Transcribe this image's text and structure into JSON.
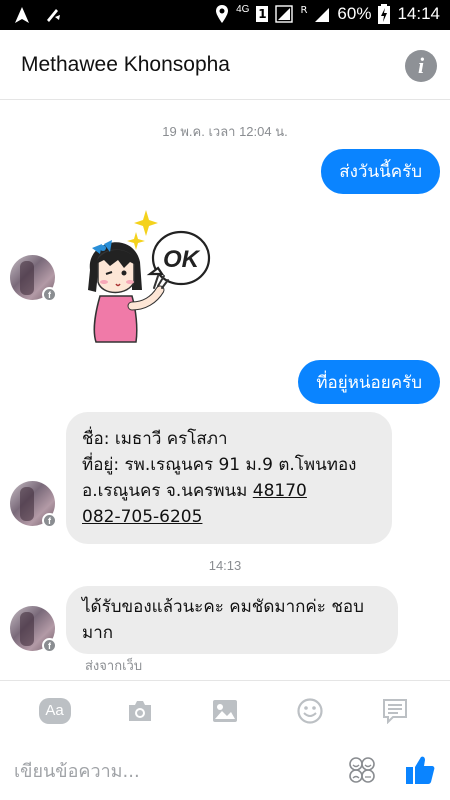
{
  "status_bar": {
    "network": "4G",
    "sim": "1",
    "roaming": "R",
    "battery": "60%",
    "time": "14:14"
  },
  "header": {
    "contact_name": "Methawee Khonsopha",
    "info_icon": "info-icon"
  },
  "messages": {
    "timestamp1": "19 พ.ค. เวลา 12:04 น.",
    "out1": "ส่งวันนี้ครับ",
    "sticker_text": "OK",
    "out2": "ที่อยู่หน่อยครับ",
    "in_address": {
      "line1": "ชื่อ: เมธาวี ครโสภา",
      "line2": "ที่อยู่: รพ.เรณูนคร 91 ม.9 ต.โพนทอง",
      "line3_prefix": "อ.เรณูนคร จ.นครพนม ",
      "postcode": "48170",
      "phone": "082-705-6205"
    },
    "timestamp2": "14:13",
    "in_last": "ได้รับของแล้วนะคะ คมชัดมากค่ะ ชอบมาก",
    "sent_from": "ส่งจากเว็บ"
  },
  "toolbar": {
    "text_mode": "Aa",
    "icons": [
      "camera-icon",
      "gallery-icon",
      "emoji-icon",
      "chat-icon"
    ]
  },
  "compose": {
    "placeholder": "เขียนข้อความ..."
  },
  "colors": {
    "accent": "#0a84ff",
    "incoming_bubble": "#ececec",
    "muted_text": "#8a8d91"
  }
}
